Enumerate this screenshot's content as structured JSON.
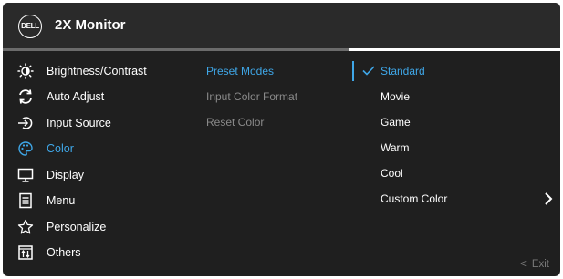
{
  "header": {
    "logo_text": "DELL",
    "title": "2X Monitor"
  },
  "main_menu": [
    {
      "label": "Brightness/Contrast",
      "icon": "brightness-icon",
      "active": false
    },
    {
      "label": "Auto Adjust",
      "icon": "auto-adjust-icon",
      "active": false
    },
    {
      "label": "Input Source",
      "icon": "input-source-icon",
      "active": false
    },
    {
      "label": "Color",
      "icon": "color-palette-icon",
      "active": true
    },
    {
      "label": "Display",
      "icon": "display-icon",
      "active": false
    },
    {
      "label": "Menu",
      "icon": "menu-icon",
      "active": false
    },
    {
      "label": "Personalize",
      "icon": "star-icon",
      "active": false
    },
    {
      "label": "Others",
      "icon": "others-icon",
      "active": false
    }
  ],
  "color_submenu": [
    {
      "label": "Preset Modes",
      "active": true
    },
    {
      "label": "Input Color Format",
      "active": false
    },
    {
      "label": "Reset Color",
      "active": false
    }
  ],
  "preset_modes": [
    {
      "label": "Standard",
      "selected": true
    },
    {
      "label": "Movie",
      "selected": false
    },
    {
      "label": "Game",
      "selected": false
    },
    {
      "label": "Warm",
      "selected": false
    },
    {
      "label": "Cool",
      "selected": false
    },
    {
      "label": "Custom Color",
      "selected": false
    }
  ],
  "footer": {
    "exit_glyph": "<",
    "exit_label": "Exit"
  },
  "colors": {
    "background": "#1f1f1f",
    "accent": "#3fa7e8",
    "text": "#ffffff",
    "muted_text": "#8a8a8a"
  }
}
